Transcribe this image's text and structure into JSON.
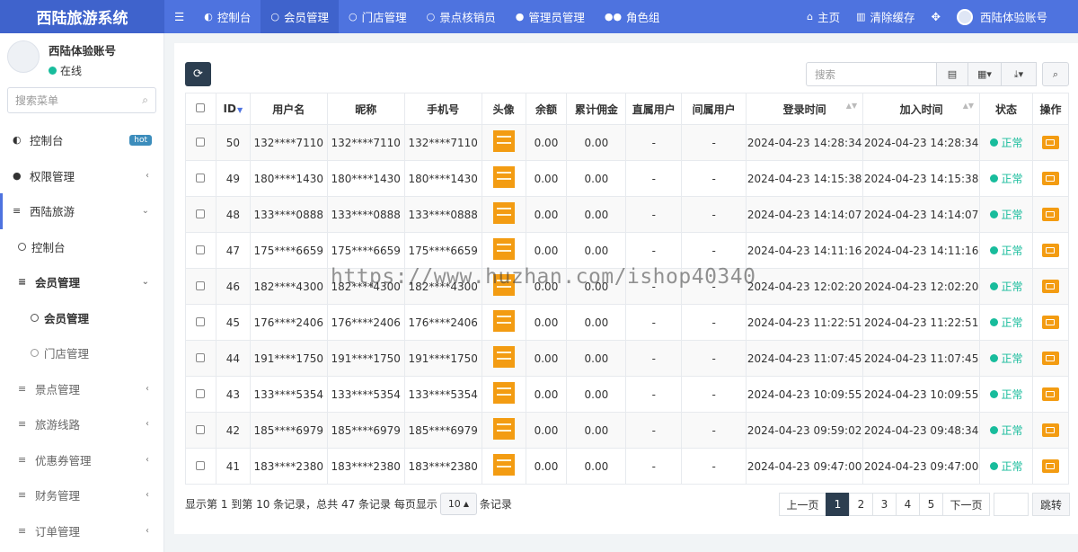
{
  "app": {
    "title": "西陆旅游系统"
  },
  "topnav": {
    "menu_toggle_icon": "bars-icon",
    "items": [
      {
        "label": "控制台",
        "icon": "dashboard-icon"
      },
      {
        "label": "会员管理",
        "icon": "circle-icon"
      },
      {
        "label": "门店管理",
        "icon": "circle-icon"
      },
      {
        "label": "景点核销员",
        "icon": "circle-icon"
      },
      {
        "label": "管理员管理",
        "icon": "user-icon"
      },
      {
        "label": "角色组",
        "icon": "group-icon"
      }
    ],
    "right": {
      "home": "主页",
      "clear_cache": "清除缓存",
      "account": "西陆体验账号"
    }
  },
  "sidebar": {
    "user": {
      "name": "西陆体验账号",
      "status": "在线"
    },
    "search_placeholder": "搜索菜单",
    "items": [
      {
        "label": "控制台",
        "badge": "hot"
      },
      {
        "label": "权限管理"
      },
      {
        "label": "西陆旅游"
      },
      {
        "label": "控制台"
      },
      {
        "label": "会员管理"
      },
      {
        "label": "会员管理"
      },
      {
        "label": "门店管理"
      },
      {
        "label": "景点管理"
      },
      {
        "label": "旅游线路"
      },
      {
        "label": "优惠券管理"
      },
      {
        "label": "财务管理"
      },
      {
        "label": "订单管理"
      }
    ]
  },
  "toolbar": {
    "search_placeholder": "搜索"
  },
  "table": {
    "headers": [
      "ID",
      "用户名",
      "昵称",
      "手机号",
      "头像",
      "余额",
      "累计佣金",
      "直属用户",
      "间属用户",
      "登录时间",
      "加入时间",
      "状态",
      "操作"
    ],
    "rows": [
      {
        "id": "50",
        "username": "132****7110",
        "nickname": "132****7110",
        "phone": "132****7110",
        "balance": "0.00",
        "commission": "0.00",
        "direct": "-",
        "indirect": "-",
        "login": "2024-04-23 14:28:34",
        "joined": "2024-04-23 14:28:34",
        "status": "正常"
      },
      {
        "id": "49",
        "username": "180****1430",
        "nickname": "180****1430",
        "phone": "180****1430",
        "balance": "0.00",
        "commission": "0.00",
        "direct": "-",
        "indirect": "-",
        "login": "2024-04-23 14:15:38",
        "joined": "2024-04-23 14:15:38",
        "status": "正常"
      },
      {
        "id": "48",
        "username": "133****0888",
        "nickname": "133****0888",
        "phone": "133****0888",
        "balance": "0.00",
        "commission": "0.00",
        "direct": "-",
        "indirect": "-",
        "login": "2024-04-23 14:14:07",
        "joined": "2024-04-23 14:14:07",
        "status": "正常"
      },
      {
        "id": "47",
        "username": "175****6659",
        "nickname": "175****6659",
        "phone": "175****6659",
        "balance": "0.00",
        "commission": "0.00",
        "direct": "-",
        "indirect": "-",
        "login": "2024-04-23 14:11:16",
        "joined": "2024-04-23 14:11:16",
        "status": "正常"
      },
      {
        "id": "46",
        "username": "182****4300",
        "nickname": "182****4300",
        "phone": "182****4300",
        "balance": "0.00",
        "commission": "0.00",
        "direct": "-",
        "indirect": "-",
        "login": "2024-04-23 12:02:20",
        "joined": "2024-04-23 12:02:20",
        "status": "正常"
      },
      {
        "id": "45",
        "username": "176****2406",
        "nickname": "176****2406",
        "phone": "176****2406",
        "balance": "0.00",
        "commission": "0.00",
        "direct": "-",
        "indirect": "-",
        "login": "2024-04-23 11:22:51",
        "joined": "2024-04-23 11:22:51",
        "status": "正常"
      },
      {
        "id": "44",
        "username": "191****1750",
        "nickname": "191****1750",
        "phone": "191****1750",
        "balance": "0.00",
        "commission": "0.00",
        "direct": "-",
        "indirect": "-",
        "login": "2024-04-23 11:07:45",
        "joined": "2024-04-23 11:07:45",
        "status": "正常"
      },
      {
        "id": "43",
        "username": "133****5354",
        "nickname": "133****5354",
        "phone": "133****5354",
        "balance": "0.00",
        "commission": "0.00",
        "direct": "-",
        "indirect": "-",
        "login": "2024-04-23 10:09:55",
        "joined": "2024-04-23 10:09:55",
        "status": "正常"
      },
      {
        "id": "42",
        "username": "185****6979",
        "nickname": "185****6979",
        "phone": "185****6979",
        "balance": "0.00",
        "commission": "0.00",
        "direct": "-",
        "indirect": "-",
        "login": "2024-04-23 09:59:02",
        "joined": "2024-04-23 09:48:34",
        "status": "正常"
      },
      {
        "id": "41",
        "username": "183****2380",
        "nickname": "183****2380",
        "phone": "183****2380",
        "balance": "0.00",
        "commission": "0.00",
        "direct": "-",
        "indirect": "-",
        "login": "2024-04-23 09:47:00",
        "joined": "2024-04-23 09:47:00",
        "status": "正常"
      }
    ]
  },
  "footer": {
    "summary": "显示第 1 到第 10 条记录，总共 47 条记录 每页显示",
    "page_size": "10",
    "suffix": "条记录"
  },
  "pagination": {
    "prev": "上一页",
    "pages": [
      "1",
      "2",
      "3",
      "4",
      "5"
    ],
    "current": "1",
    "next": "下一页",
    "jump": "跳转"
  },
  "watermark": "https://www.huzhan.com/ishop40340",
  "colors": {
    "topbar": "#4e73df",
    "brand": "#3f63cc",
    "success": "#18bc9c",
    "warning": "#f39c12",
    "dark": "#2c3e50"
  }
}
